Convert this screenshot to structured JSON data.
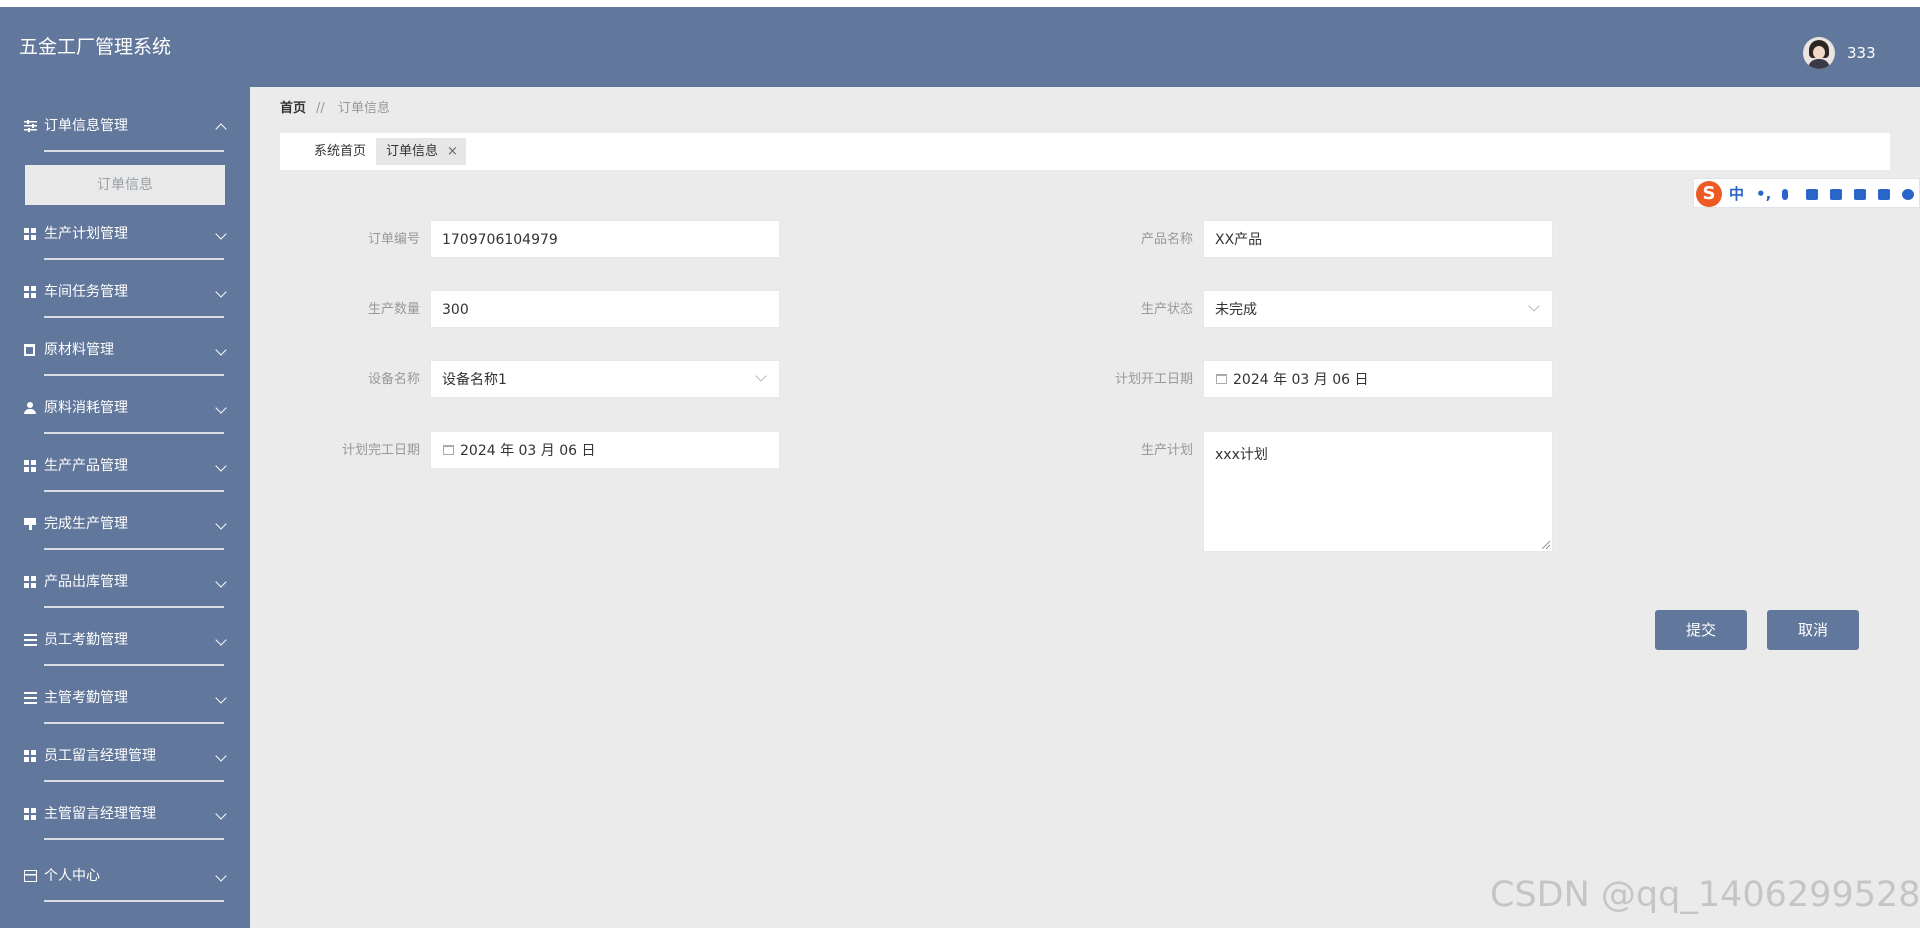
{
  "header": {
    "title": "五金工厂管理系统",
    "username": "333"
  },
  "sidebar": {
    "items": [
      {
        "label": "订单信息管理",
        "icon": "sliders-icon",
        "expanded": true
      },
      {
        "label": "生产计划管理",
        "icon": "grid-icon"
      },
      {
        "label": "车间任务管理",
        "icon": "grid-icon"
      },
      {
        "label": "原材料管理",
        "icon": "clipboard-icon"
      },
      {
        "label": "原料消耗管理",
        "icon": "user-icon"
      },
      {
        "label": "生产产品管理",
        "icon": "grid-icon"
      },
      {
        "label": "完成生产管理",
        "icon": "flag-icon"
      },
      {
        "label": "产品出库管理",
        "icon": "grid-icon"
      },
      {
        "label": "员工考勤管理",
        "icon": "list-icon"
      },
      {
        "label": "主管考勤管理",
        "icon": "list-icon"
      },
      {
        "label": "员工留言经理管理",
        "icon": "grid-icon"
      },
      {
        "label": "主管留言经理管理",
        "icon": "grid-icon"
      },
      {
        "label": "个人中心",
        "icon": "card-icon"
      }
    ],
    "submenu": {
      "label": "订单信息"
    }
  },
  "breadcrumb": {
    "home": "首页",
    "separator": "//",
    "current": "订单信息"
  },
  "tabs": [
    {
      "label": "系统首页"
    },
    {
      "label": "订单信息",
      "close": "×"
    }
  ],
  "ime": {
    "logo": "S",
    "mode": "中",
    "punct": "•,"
  },
  "form": {
    "order_no": {
      "label": "订单编号",
      "value": "1709706104979"
    },
    "product_name": {
      "label": "产品名称",
      "value": "XX产品"
    },
    "quantity": {
      "label": "生产数量",
      "value": "300"
    },
    "status": {
      "label": "生产状态",
      "value": "未完成"
    },
    "equipment": {
      "label": "设备名称",
      "value": "设备名称1"
    },
    "plan_start": {
      "label": "计划开工日期",
      "value": "2024 年 03 月 06 日"
    },
    "plan_end": {
      "label": "计划完工日期",
      "value": "2024 年 03 月 06 日"
    },
    "plan": {
      "label": "生产计划",
      "value": "xxx计划"
    }
  },
  "buttons": {
    "submit": "提交",
    "cancel": "取消"
  },
  "watermark": "CSDN @qq_1406299528",
  "colors": {
    "primary": "#61779b",
    "background": "#ebebeb",
    "ime_accent": "#2a66c9",
    "ime_logo": "#ee5a24"
  }
}
